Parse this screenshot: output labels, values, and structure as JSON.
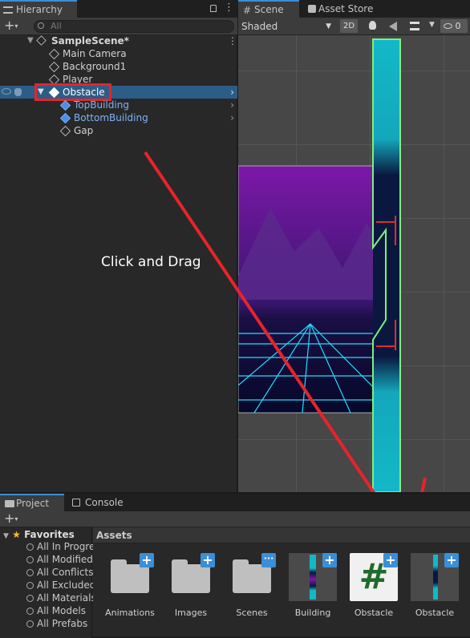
{
  "hierarchy": {
    "tab_label": "Hierarchy",
    "search_placeholder": "All",
    "scene_name": "SampleScene*",
    "items": [
      {
        "label": "Main Camera"
      },
      {
        "label": "Background1"
      },
      {
        "label": "Player"
      },
      {
        "label": "Obstacle"
      },
      {
        "label": "TopBuilding"
      },
      {
        "label": "BottomBuilding"
      },
      {
        "label": "Gap"
      }
    ]
  },
  "scene": {
    "tab_label": "Scene",
    "asset_store_label": "Asset Store",
    "shading_mode": "Shaded",
    "mode_2d": "2D",
    "hidden_count": "0"
  },
  "annotation": {
    "text": "Click and Drag",
    "color": "#e8232a"
  },
  "project": {
    "tab_label": "Project",
    "console_label": "Console",
    "favorites_label": "Favorites",
    "favorites": [
      "All In Progress",
      "All Modified",
      "All Conflicts",
      "All Excluded",
      "All Materials",
      "All Models",
      "All Prefabs"
    ],
    "assets_label": "Assets",
    "assets": [
      {
        "label": "Animations",
        "kind": "folder"
      },
      {
        "label": "Images",
        "kind": "folder"
      },
      {
        "label": "Scenes",
        "kind": "folder"
      },
      {
        "label": "Building",
        "kind": "prefab"
      },
      {
        "label": "Obstacle",
        "kind": "script"
      },
      {
        "label": "Obstacle",
        "kind": "prefab"
      }
    ]
  },
  "colors": {
    "selection": "#2c5d87",
    "accent_blue": "#3a8fd6",
    "cyan_building": "#17b3c4",
    "outline_green": "#7ff07f"
  }
}
